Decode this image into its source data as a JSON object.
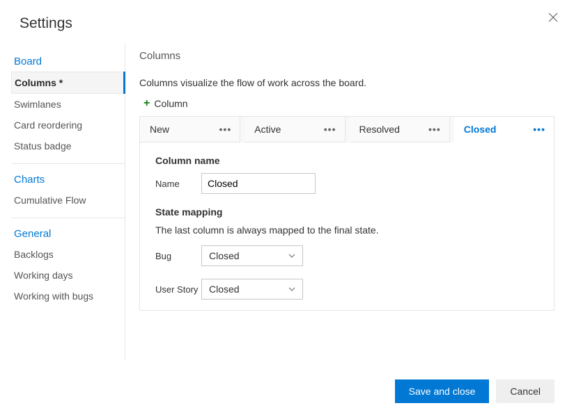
{
  "header": {
    "title": "Settings"
  },
  "sidebar": {
    "groups": [
      {
        "title": "Board",
        "items": [
          {
            "label": "Columns *",
            "selected": true
          },
          {
            "label": "Swimlanes"
          },
          {
            "label": "Card reordering"
          },
          {
            "label": "Status badge"
          }
        ]
      },
      {
        "title": "Charts",
        "items": [
          {
            "label": "Cumulative Flow"
          }
        ]
      },
      {
        "title": "General",
        "items": [
          {
            "label": "Backlogs"
          },
          {
            "label": "Working days"
          },
          {
            "label": "Working with bugs"
          }
        ]
      }
    ]
  },
  "main": {
    "title": "Columns",
    "description": "Columns visualize the flow of work across the board.",
    "add_label": "Column",
    "tabs": [
      {
        "label": "New"
      },
      {
        "label": "Active"
      },
      {
        "label": "Resolved"
      },
      {
        "label": "Closed",
        "active": true
      }
    ],
    "column_name": {
      "heading": "Column name",
      "label": "Name",
      "value": "Closed"
    },
    "state_mapping": {
      "heading": "State mapping",
      "sub": "The last column is always mapped to the final state.",
      "rows": [
        {
          "label": "Bug",
          "value": "Closed"
        },
        {
          "label": "User Story",
          "value": "Closed"
        }
      ]
    }
  },
  "footer": {
    "primary": "Save and close",
    "secondary": "Cancel"
  }
}
